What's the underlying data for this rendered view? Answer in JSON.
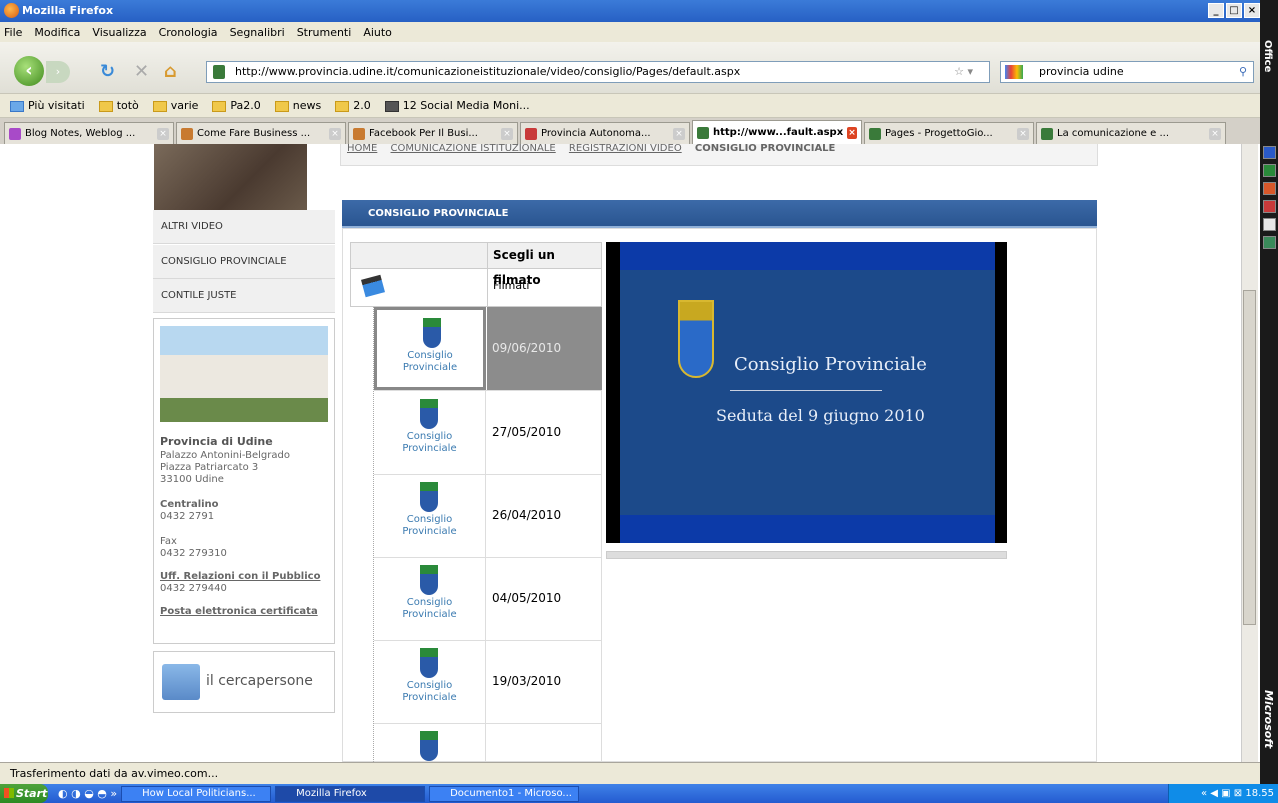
{
  "window": {
    "title": "Mozilla Firefox"
  },
  "menu": [
    "File",
    "Modifica",
    "Visualizza",
    "Cronologia",
    "Segnalibri",
    "Strumenti",
    "Aiuto"
  ],
  "url": "http://www.provincia.udine.it/comunicazioneistituzionale/video/consiglio/Pages/default.aspx",
  "search_value": "provincia udine",
  "bookmarks": [
    "Più visitati",
    "totò",
    "varie",
    "Pa2.0",
    "news",
    "2.0",
    "12 Social Media Moni..."
  ],
  "tabs": [
    "Blog Notes, Weblog ...",
    "Come Fare Business ...",
    "Facebook Per Il Busi...",
    "Provincia Autonoma...",
    "http://www...fault.aspx",
    "Pages - ProgettoGio...",
    "La comunicazione e ..."
  ],
  "breadcrumb": [
    "HOME",
    "COMUNICAZIONE ISTITUZIONALE",
    "REGISTRAZIONI VIDEO",
    "CONSIGLIO PROVINCIALE"
  ],
  "leftnav": [
    "ALTRI VIDEO",
    "CONSIGLIO PROVINCIALE",
    "CONTILE JUSTE"
  ],
  "info": {
    "name": "Provincia di Udine",
    "address1": "Palazzo Antonini-Belgrado",
    "address2": "Piazza Patriarcato 3",
    "address3": "33100 Udine",
    "centralino_label": "Centralino",
    "centralino": "0432 2791",
    "fax_label": "Fax",
    "fax": "0432 279310",
    "urp_label": "Uff. Relazioni con il Pubblico",
    "urp": "0432 279440",
    "pec": "Posta elettronica certificata"
  },
  "cercapersone": "il cercapersone",
  "section_title": "CONSIGLIO PROVINCIALE",
  "grid": {
    "header": "Scegli un filmato",
    "filmati": "Filmati",
    "thumb_label1": "Consiglio",
    "thumb_label2": "Provinciale",
    "dates": [
      "09/06/2010",
      "27/05/2010",
      "26/04/2010",
      "04/05/2010",
      "19/03/2010"
    ]
  },
  "video": {
    "title": "Consiglio Provinciale",
    "subtitle": "Seduta del 9 giugno 2010"
  },
  "status": "Trasferimento dati da av.vimeo.com...",
  "taskbar": {
    "start": "Start",
    "items": [
      "How Local Politicians...",
      "Mozilla Firefox",
      "Documento1 - Microso..."
    ],
    "clock": "18.55"
  },
  "right_sidebar": {
    "top": "Office",
    "bottom": "Microsoft"
  }
}
